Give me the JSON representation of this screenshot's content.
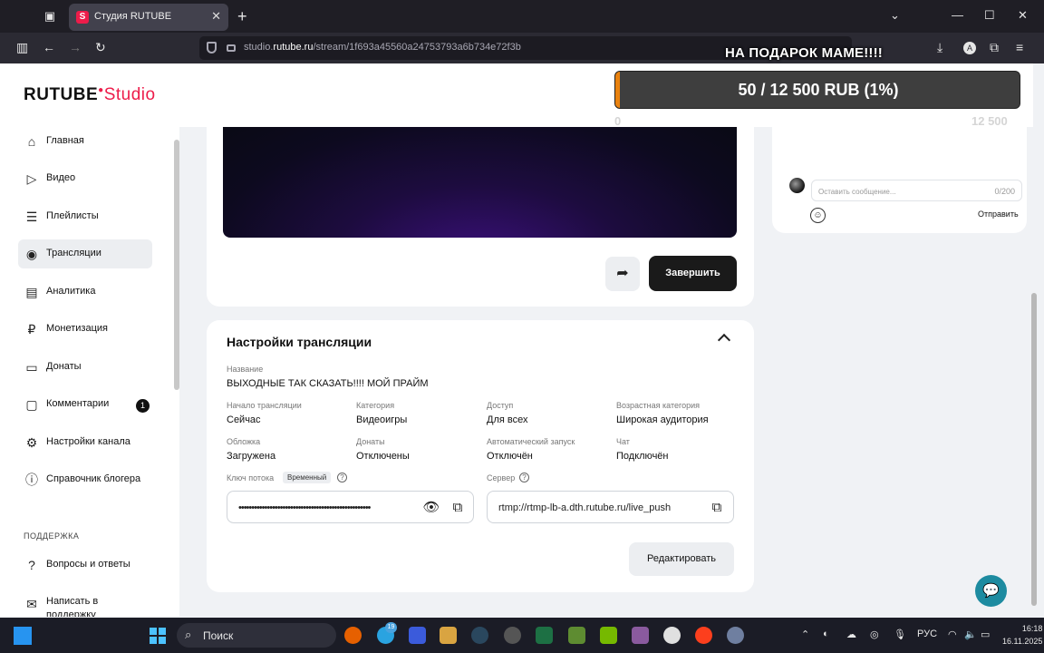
{
  "browser": {
    "tab_title": "Студия RUTUBE",
    "url_prefix": "studio.",
    "url_domain": "rutube.ru",
    "url_path": "/stream/1f693a45560a24753793a6b734e72f3b"
  },
  "overlay": {
    "title": "НА ПОДАРОК МАМЕ!!!!",
    "goal_text": "50 / 12 500 RUB (1%)",
    "goal_min": "0",
    "goal_max": "12 500",
    "goal_fraction": 0.004
  },
  "logo": {
    "part1": "RUTUBE",
    "part2": "Studio"
  },
  "sidebar": {
    "items": [
      {
        "label": "Главная",
        "icon": "home-icon"
      },
      {
        "label": "Видео",
        "icon": "video-icon"
      },
      {
        "label": "Плейлисты",
        "icon": "playlist-icon"
      },
      {
        "label": "Трансляции",
        "icon": "broadcast-icon"
      },
      {
        "label": "Аналитика",
        "icon": "analytics-icon"
      },
      {
        "label": "Монетизация",
        "icon": "ruble-icon"
      },
      {
        "label": "Донаты",
        "icon": "donate-icon"
      },
      {
        "label": "Комментарии",
        "icon": "comment-icon",
        "badge": "1"
      },
      {
        "label": "Настройки канала",
        "icon": "gear-icon"
      },
      {
        "label": "Справочник блогера",
        "icon": "info-icon"
      }
    ],
    "support_heading": "ПОДДЕРЖКА",
    "support_items": [
      {
        "label": "Вопросы и ответы",
        "icon": "question-icon"
      },
      {
        "label": "Написать в поддержку",
        "icon": "mail-icon"
      }
    ]
  },
  "stream": {
    "end_button": "Завершить"
  },
  "settings": {
    "title": "Настройки трансляции",
    "name_label": "Название",
    "name_value": "ВЫХОДНЫЕ ТАК СКАЗАТЬ!!!! МОЙ ПРАЙМ",
    "fields": [
      {
        "label": "Начало трансляции",
        "value": "Сейчас"
      },
      {
        "label": "Категория",
        "value": "Видеоигры"
      },
      {
        "label": "Доступ",
        "value": "Для всех"
      },
      {
        "label": "Возрастная категория",
        "value": "Широкая аудитория"
      },
      {
        "label": "Обложка",
        "value": "Загружена"
      },
      {
        "label": "Донаты",
        "value": "Отключены"
      },
      {
        "label": "Автоматический запуск",
        "value": "Отключён"
      },
      {
        "label": "Чат",
        "value": "Подключён"
      }
    ],
    "key_label": "Ключ потока",
    "key_tag": "Временный",
    "key_value": "•••••••••••••••••••••••••••••••••••••••••••••••••••",
    "server_label": "Сервер",
    "server_value": "rtmp://rtmp-lb-a.dth.rutube.ru/live_push",
    "edit_button": "Редактировать"
  },
  "chat": {
    "placeholder": "Оставить сообщение...",
    "counter": "0/200",
    "send_label": "Отправить"
  },
  "taskbar": {
    "search_label": "Поиск",
    "telegram_badge": "19",
    "lang": "РУС",
    "time": "16:18",
    "date": "16.11.2025"
  }
}
